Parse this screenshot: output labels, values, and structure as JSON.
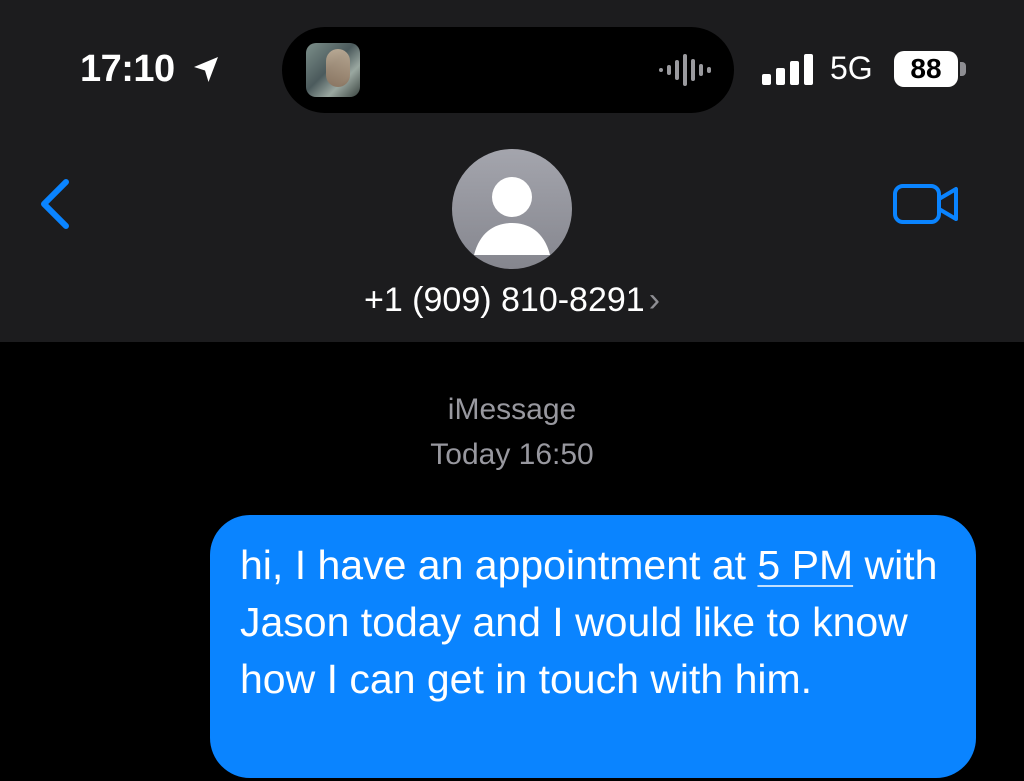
{
  "status_bar": {
    "time": "17:10",
    "network": "5G",
    "battery": "88"
  },
  "icons": {
    "location": "location-arrow-icon",
    "waveform": "audio-waveform-icon",
    "signal": "cellular-signal-icon",
    "back": "chevron-left-icon",
    "video": "video-camera-icon",
    "avatar": "person-placeholder-icon",
    "contact_chevron": "chevron-right-icon"
  },
  "header": {
    "contact": "+1 (909) 810-8291",
    "chevron": "›"
  },
  "conversation": {
    "service": "iMessage",
    "timestamp": "Today 16:50",
    "message": {
      "before_link": "hi, I have an appointment at ",
      "link": "5 PM",
      "after_link": " with Jason today and I would like to know how I can get in touch with him."
    }
  },
  "colors": {
    "accent": "#0a84ff",
    "header_bg": "#1c1c1e",
    "bubble": "#0a84ff",
    "secondary_text": "#98989f"
  }
}
